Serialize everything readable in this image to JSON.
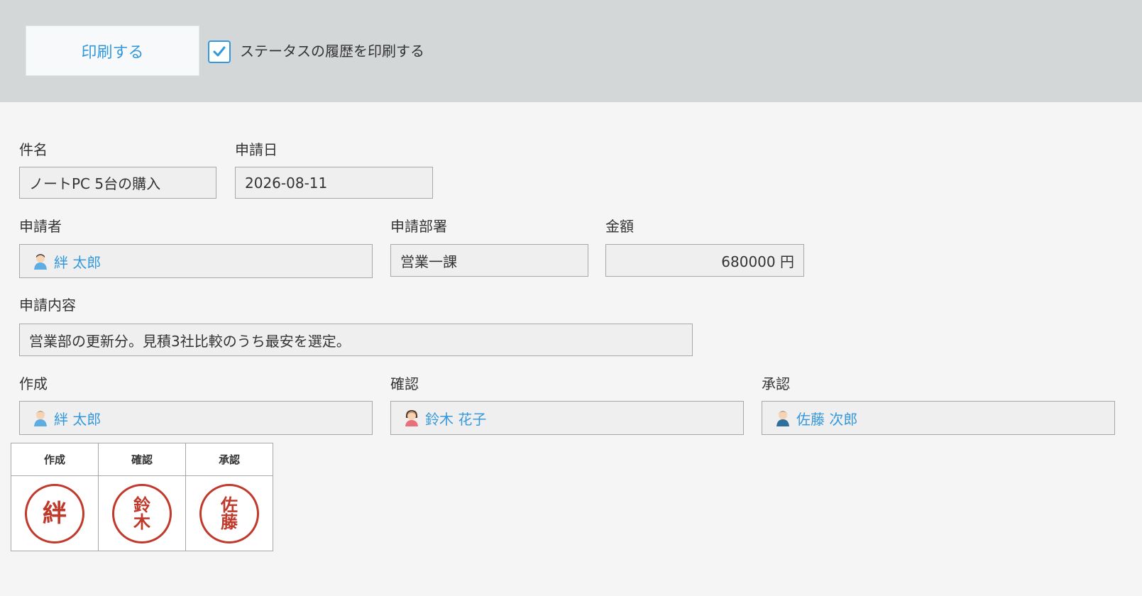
{
  "toolbar": {
    "print_label": "印刷する",
    "history_checkbox": {
      "label": "ステータスの履歴を印刷する",
      "checked": true
    }
  },
  "form": {
    "subject": {
      "label": "件名",
      "value": "ノートPC 5台の購入"
    },
    "apply_date": {
      "label": "申請日",
      "value": "2026-08-11"
    },
    "applicant": {
      "label": "申請者",
      "value": "絆 太郎"
    },
    "department": {
      "label": "申請部署",
      "value": "営業一課"
    },
    "amount": {
      "label": "金額",
      "value": "680000 円"
    },
    "content": {
      "label": "申請内容",
      "value": "営業部の更新分。見積3社比較のうち最安を選定。"
    },
    "creator": {
      "label": "作成",
      "value": "絆 太郎"
    },
    "checker": {
      "label": "確認",
      "value": "鈴木 花子"
    },
    "approver": {
      "label": "承認",
      "value": "佐藤 次郎"
    }
  },
  "stamps": {
    "headers": [
      "作成",
      "確認",
      "承認"
    ],
    "seals": [
      "絆",
      "鈴木",
      "佐藤"
    ]
  },
  "colors": {
    "accent": "#3498db",
    "seal": "#c0392b",
    "toolbar_bg": "#d4d7d8",
    "page_bg": "#f5f5f5",
    "field_bg": "#efefef"
  },
  "icons": {
    "avatar_male": "user-avatar-icon",
    "avatar_female": "user-avatar-female-icon",
    "check": "checkmark-icon"
  }
}
